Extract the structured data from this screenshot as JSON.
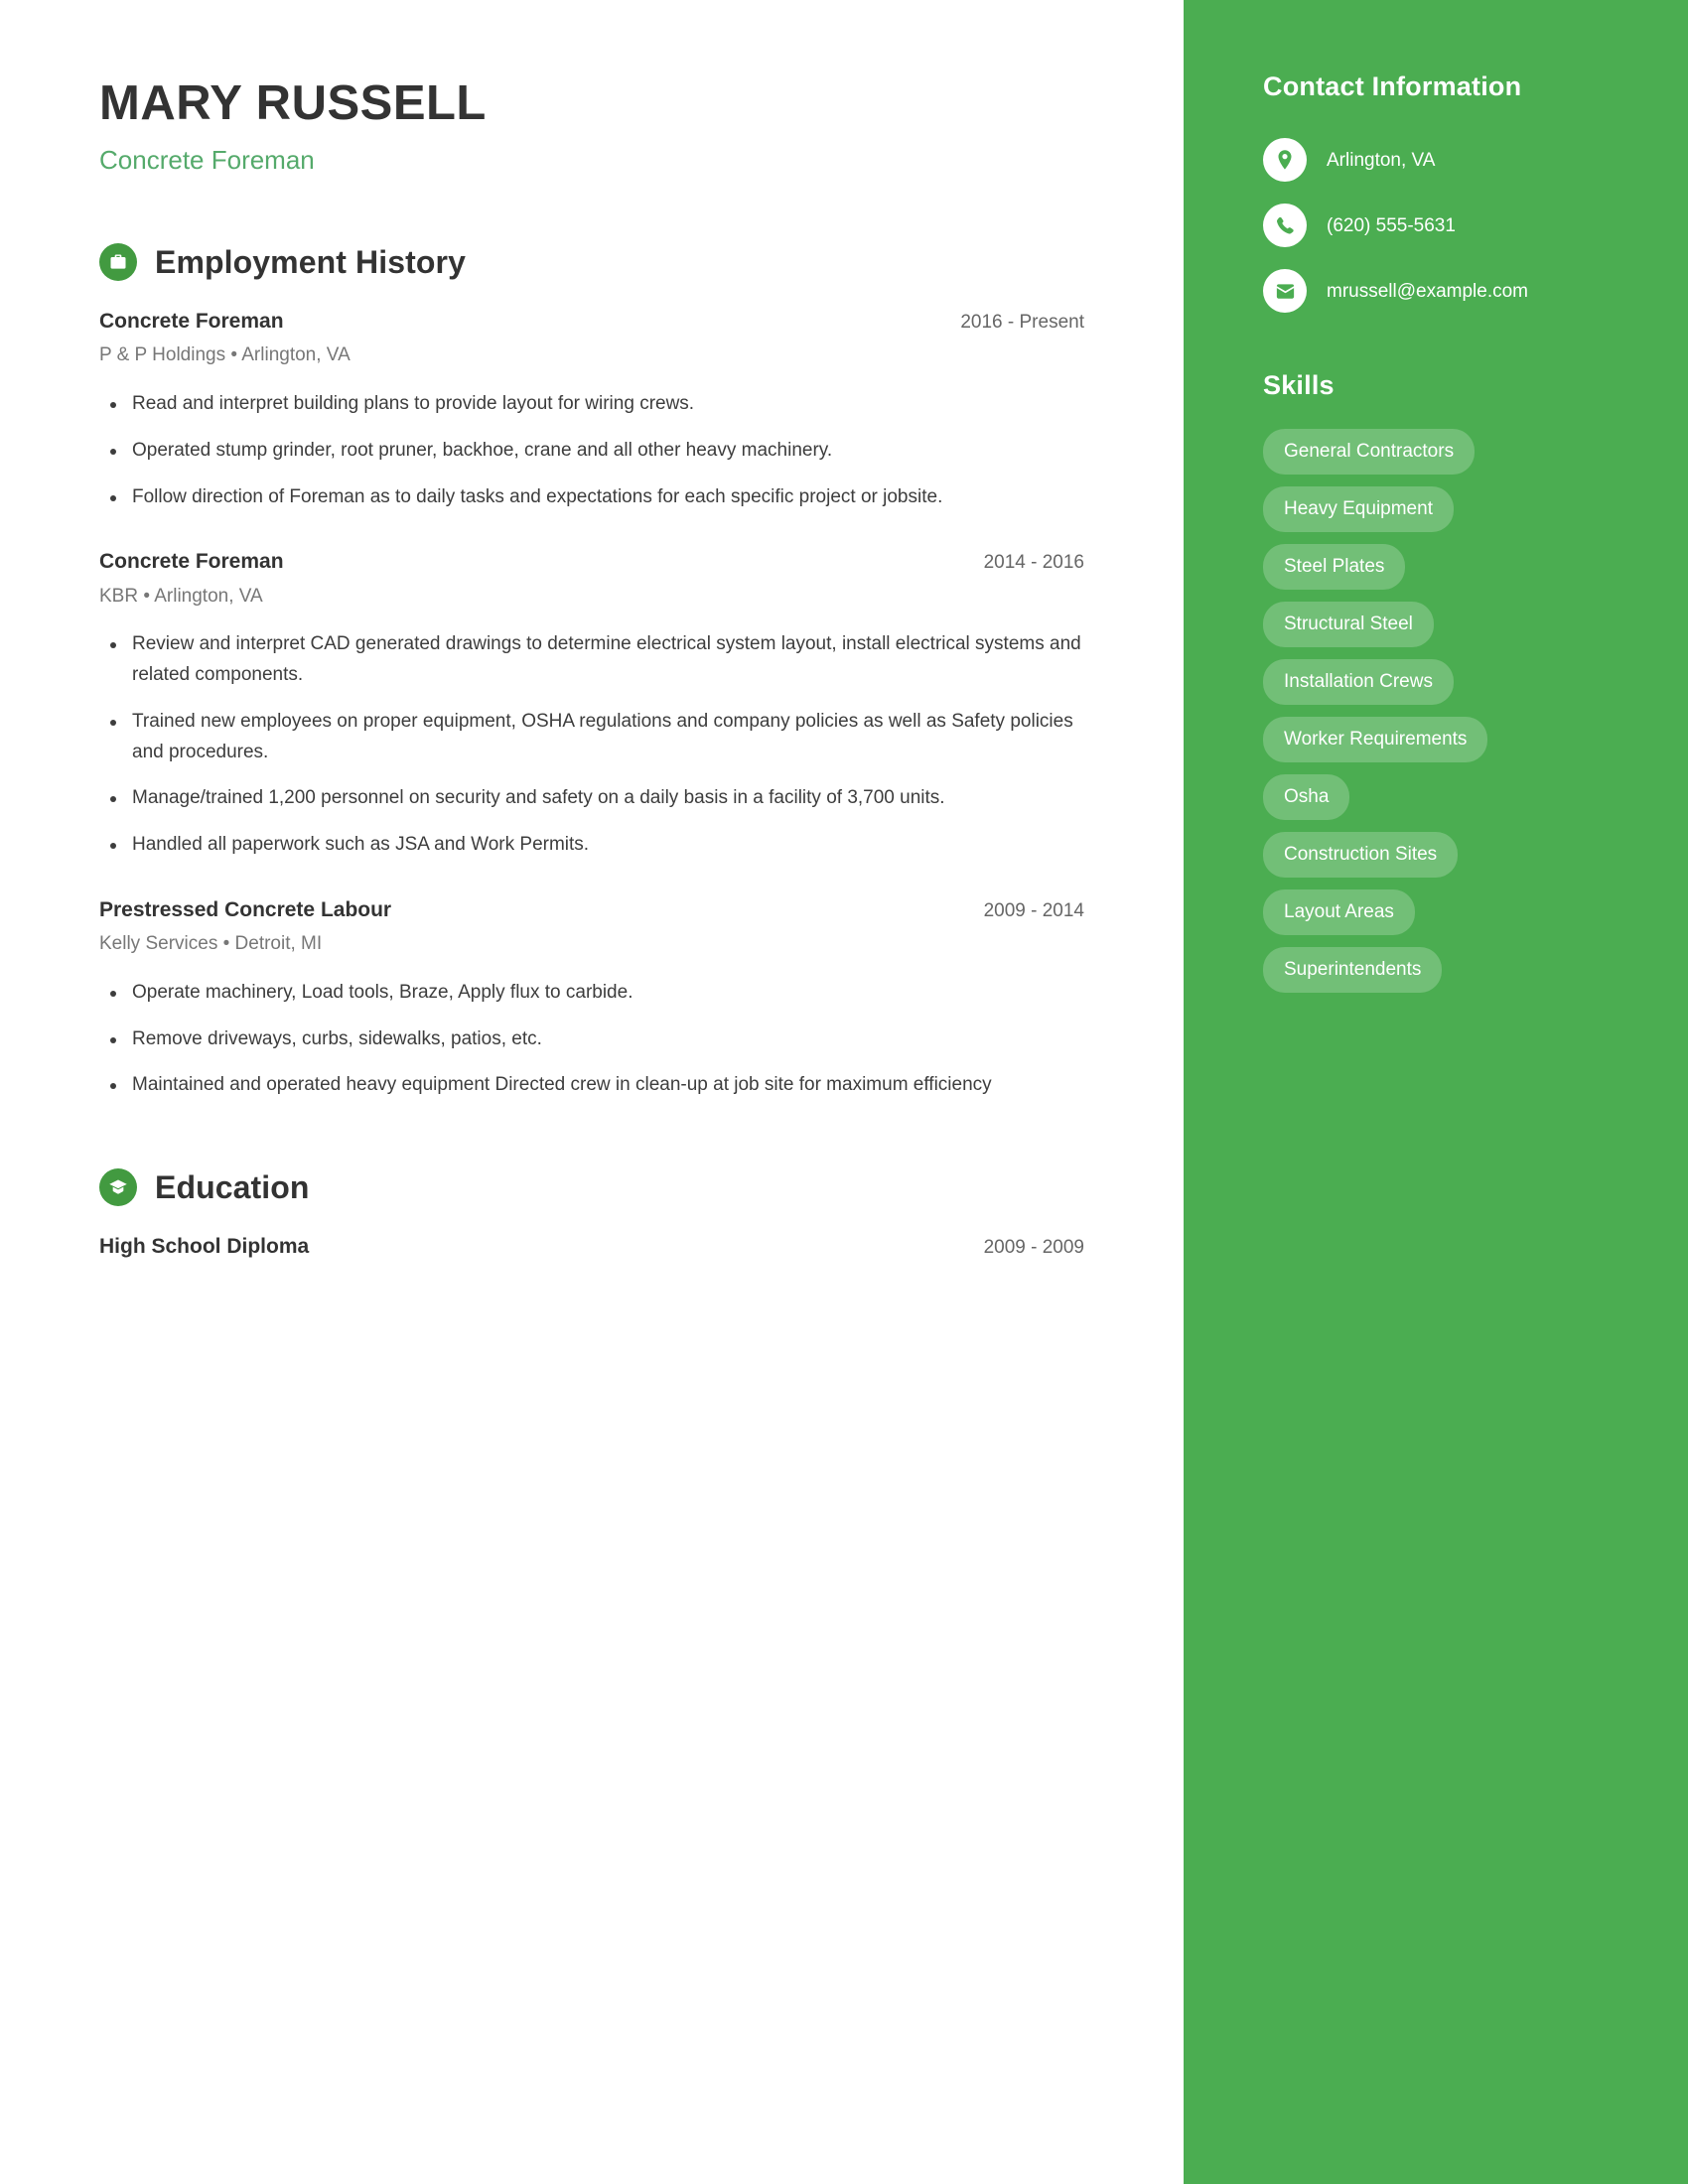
{
  "header": {
    "name": "MARY RUSSELL",
    "title": "Concrete Foreman"
  },
  "colors": {
    "sidebar_green": "#4bad51",
    "accent_green": "#55aa6b",
    "icon_green": "#429a40",
    "heading_dark": "#333333"
  },
  "sections": {
    "employment": {
      "title": "Employment History",
      "icon": "briefcase-icon",
      "entries": [
        {
          "title": "Concrete Foreman",
          "dates": "2016 - Present",
          "meta": "P & P Holdings  •  Arlington, VA",
          "bullets": [
            "Read and interpret building plans to provide layout for wiring crews.",
            "Operated stump grinder, root pruner, backhoe, crane and all other heavy machinery.",
            "Follow direction of Foreman as to daily tasks and expectations for each specific project or jobsite."
          ]
        },
        {
          "title": "Concrete Foreman",
          "dates": "2014 - 2016",
          "meta": "KBR  •  Arlington, VA",
          "bullets": [
            "Review and interpret CAD generated drawings to determine electrical system layout, install electrical systems and related components.",
            "Trained new employees on proper equipment, OSHA regulations and company policies as well as Safety policies and procedures.",
            "Manage/trained 1,200 personnel on security and safety on a daily basis in a facility of 3,700 units.",
            "Handled all paperwork such as JSA and Work Permits."
          ]
        },
        {
          "title": "Prestressed Concrete Labour",
          "dates": "2009 - 2014",
          "meta": "Kelly Services  •  Detroit, MI",
          "bullets": [
            "Operate machinery, Load tools, Braze, Apply flux to carbide.",
            "Remove driveways, curbs, sidewalks, patios, etc.",
            "Maintained and operated heavy equipment Directed crew in clean-up at job site for maximum efficiency"
          ]
        }
      ]
    },
    "education": {
      "title": "Education",
      "icon": "graduation-cap-icon",
      "entries": [
        {
          "title": "High School Diploma",
          "dates": "2009 - 2009",
          "meta": "",
          "bullets": []
        }
      ]
    }
  },
  "sidebar": {
    "contact_title": "Contact Information",
    "contacts": [
      {
        "icon": "location-pin-icon",
        "value": "Arlington, VA"
      },
      {
        "icon": "phone-icon",
        "value": "(620) 555-5631"
      },
      {
        "icon": "envelope-icon",
        "value": "mrussell@example.com"
      }
    ],
    "skills_title": "Skills",
    "skills": [
      "General Contractors",
      "Heavy Equipment",
      "Steel Plates",
      "Structural Steel",
      "Installation Crews",
      "Worker Requirements",
      "Osha",
      "Construction Sites",
      "Layout Areas",
      "Superintendents"
    ]
  }
}
